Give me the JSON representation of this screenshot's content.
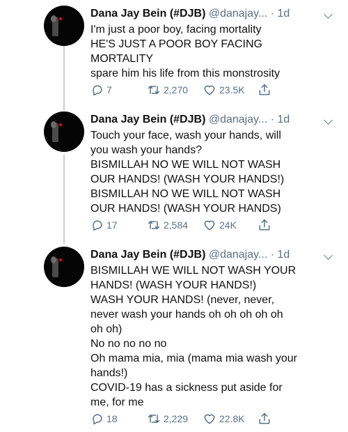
{
  "author": {
    "name": "Dana Jay Bein (#DJB)",
    "handle": "@danajay...",
    "separator": "·"
  },
  "tweets": [
    {
      "time": "1d",
      "lines": [
        "I'm just a poor boy, facing mortality",
        "HE'S JUST A POOR BOY FACING",
        "MORTALITY",
        "spare him his life from this monstrosity"
      ],
      "replies": "7",
      "retweets": "2,270",
      "likes": "23.5K"
    },
    {
      "time": "1d",
      "lines": [
        "Touch your face, wash your hands, will",
        "you wash your hands?",
        "BISMILLAH NO WE WILL NOT WASH",
        "OUR HANDS! (WASH YOUR HANDS!)",
        "BISMILLAH NO WE WILL NOT WASH",
        "OUR HANDS! (WASH YOUR HANDS)"
      ],
      "replies": "17",
      "retweets": "2,584",
      "likes": "24K"
    },
    {
      "time": "1d",
      "lines": [
        "BISMILLAH WE WILL NOT WASH YOUR",
        "HANDS! (WASH YOUR HANDS!)",
        "WASH YOUR HANDS! (never, never,",
        "never wash your hands oh oh oh oh oh",
        "oh oh)",
        "No no no no no",
        "Oh mama mia, mia (mama mia wash your",
        "hands!)",
        "COVID-19 has a sickness put aside for",
        "me, for me"
      ],
      "replies": "18",
      "retweets": "2,229",
      "likes": "22.8K"
    }
  ],
  "icons": {
    "reply": "reply-icon",
    "retweet": "retweet-icon",
    "like": "heart-icon",
    "share": "share-icon",
    "more": "chevron-down-icon"
  },
  "colors": {
    "text": "#111111",
    "secondary": "#5b7083",
    "thread_line": "#c4cfd6",
    "avatar_accent": "#e01414"
  }
}
